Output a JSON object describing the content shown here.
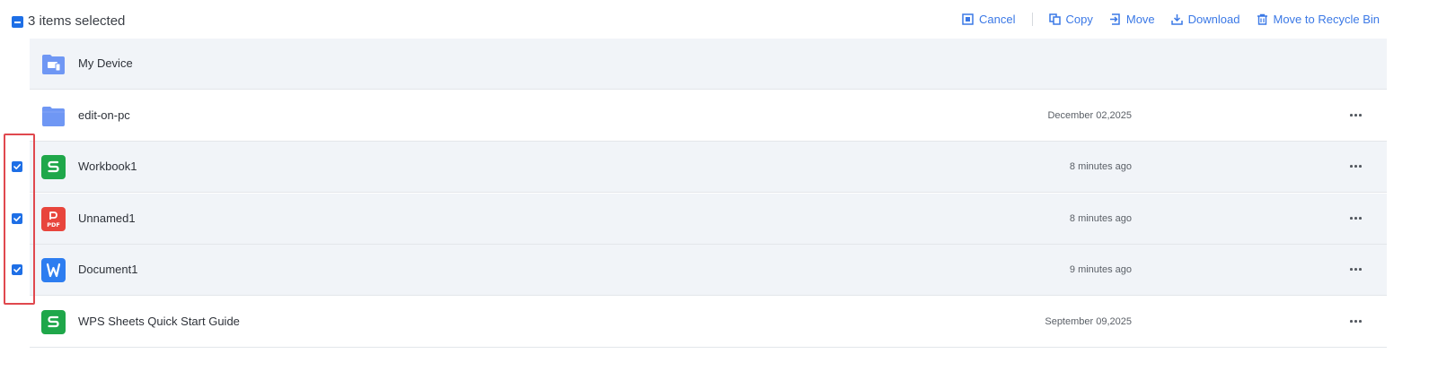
{
  "selection": {
    "count_text": "3 items selected"
  },
  "toolbar": {
    "cancel_label": "Cancel",
    "copy_label": "Copy",
    "move_label": "Move",
    "download_label": "Download",
    "recycle_label": "Move to Recycle Bin"
  },
  "files": [
    {
      "name": "My Device",
      "date": "",
      "type": "device-folder",
      "selected": false,
      "shaded": true
    },
    {
      "name": "edit-on-pc",
      "date": "December 02,2025",
      "type": "folder",
      "selected": false,
      "shaded": false
    },
    {
      "name": "Workbook1",
      "date": "8 minutes ago",
      "type": "sheet",
      "selected": true,
      "shaded": true
    },
    {
      "name": "Unnamed1",
      "date": "8 minutes ago",
      "type": "pdf",
      "selected": true,
      "shaded": true
    },
    {
      "name": "Document1",
      "date": "9 minutes ago",
      "type": "doc",
      "selected": true,
      "shaded": true
    },
    {
      "name": "WPS Sheets Quick Start Guide",
      "date": "September 09,2025",
      "type": "sheet",
      "selected": false,
      "shaded": false
    }
  ],
  "colors": {
    "accent": "#3a78e6",
    "checkbox": "#1e6fe6",
    "highlight": "#e0484e",
    "sheet": "#1fa74a",
    "pdf": "#e8453c",
    "doc": "#2d7df0",
    "folder": "#6f97f4"
  },
  "icons": {
    "cancel": "cancel-box-icon",
    "copy": "copy-icon",
    "move": "move-icon",
    "download": "download-icon",
    "recycle": "trash-icon",
    "more": "more-horizontal-icon"
  }
}
